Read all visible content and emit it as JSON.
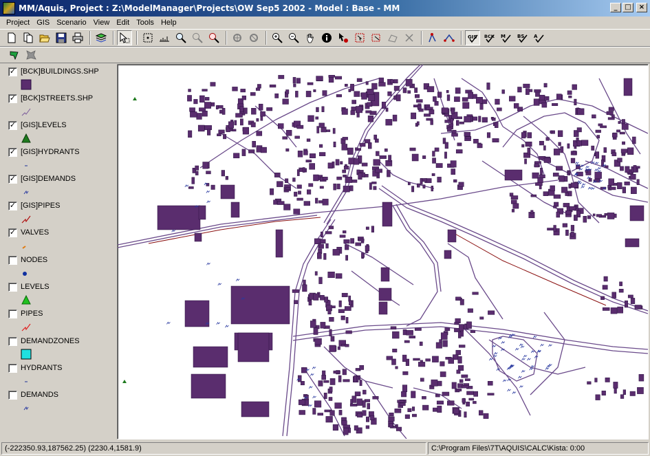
{
  "window": {
    "title": "MM/Aquis,  Project : Z:\\ModelManager\\Projects\\OW Sep5 2002 - Model : Base - MM",
    "minimize": "_",
    "maximize": "□",
    "close": "×"
  },
  "menu": [
    {
      "label": "Project"
    },
    {
      "label": "GIS"
    },
    {
      "label": "Scenario"
    },
    {
      "label": "View"
    },
    {
      "label": "Edit"
    },
    {
      "label": "Tools"
    },
    {
      "label": "Help"
    }
  ],
  "layers": [
    {
      "label": "[BCK]BUILDINGS.SHP",
      "checked": true,
      "symbol": "square",
      "color": "#5a2d6e"
    },
    {
      "label": "[BCK]STREETS.SHP",
      "checked": true,
      "symbol": "line",
      "color": "#7a5a9a"
    },
    {
      "label": "[GIS]LEVELS",
      "checked": true,
      "symbol": "triangle",
      "color": "#1e7a1e"
    },
    {
      "label": "[GIS]HYDRANTS",
      "checked": true,
      "symbol": "dash",
      "color": "#3a4aa0"
    },
    {
      "label": "[GIS]DEMANDS",
      "checked": true,
      "symbol": "demand",
      "color": "#2a3aa0"
    },
    {
      "label": "[GIS]PIPES",
      "checked": true,
      "symbol": "zigzag",
      "color": "#b01010"
    },
    {
      "label": "VALVES",
      "checked": true,
      "symbol": "valve",
      "color": "#e07a10"
    },
    {
      "label": "NODES",
      "checked": false,
      "symbol": "dot",
      "color": "#1030a0"
    },
    {
      "label": "LEVELS",
      "checked": false,
      "symbol": "triangle",
      "color": "#20c020"
    },
    {
      "label": "PIPES",
      "checked": false,
      "symbol": "zigzag",
      "color": "#e02020"
    },
    {
      "label": "DEMANDZONES",
      "checked": false,
      "symbol": "square-cyan",
      "color": "#20e0e0"
    },
    {
      "label": "HYDRANTS",
      "checked": false,
      "symbol": "dash",
      "color": "#3a4aa0"
    },
    {
      "label": "DEMANDS",
      "checked": false,
      "symbol": "demand",
      "color": "#2a3aa0"
    }
  ],
  "status": {
    "coords": "(-222350.93,187562.25) (2230.4,1581.9)",
    "path": "C:\\Program Files\\7T\\AQUIS\\CALC\\Kista:    0:00"
  }
}
